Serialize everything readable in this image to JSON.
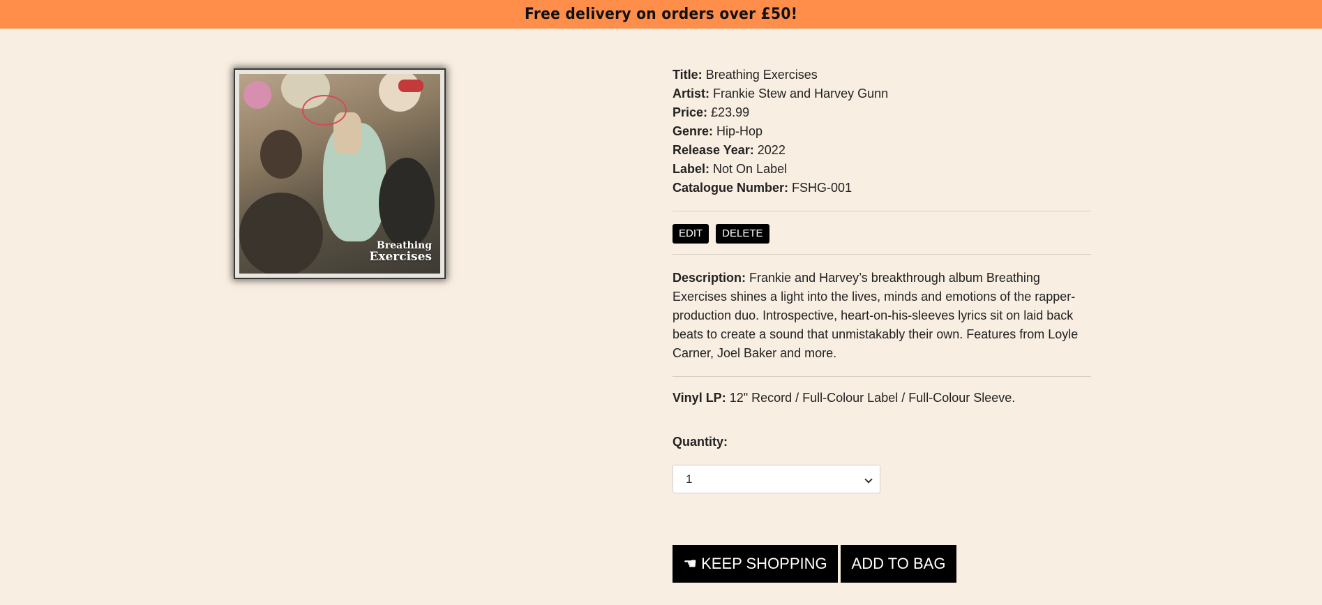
{
  "banner": {
    "text": "Free delivery on orders over £50!"
  },
  "cover": {
    "title_line1": "Breathing",
    "title_line2": "Exercises"
  },
  "product": {
    "fields": [
      {
        "key": "Title:",
        "value": "Breathing Exercises"
      },
      {
        "key": "Artist:",
        "value": "Frankie Stew and Harvey Gunn"
      },
      {
        "key": "Price:",
        "value": "£23.99"
      },
      {
        "key": "Genre:",
        "value": "Hip-Hop"
      },
      {
        "key": "Release Year:",
        "value": "2022"
      },
      {
        "key": "Label:",
        "value": "Not On Label"
      },
      {
        "key": "Catalogue Number:",
        "value": "FSHG-001"
      }
    ],
    "edit_label": "EDIT",
    "delete_label": "DELETE",
    "description_key": "Description:",
    "description": "Frankie and Harvey’s breakthrough album Breathing Exercises shines a light into the lives, minds and emotions of the rapper-production duo. Introspective, heart-on-his-sleeves lyrics sit on laid back beats to create a sound that unmistakably their own. Features from Loyle Carner, Joel Baker and more.",
    "format_key": "Vinyl LP:",
    "format_value": "12\" Record / Full-Colour Label / Full-Colour Sleeve.",
    "quantity_label": "Quantity:",
    "quantity_value": "1",
    "keep_shopping_label": "KEEP SHOPPING",
    "add_to_bag_label": "ADD TO BAG"
  },
  "icons": {
    "keep_shopping": "pointing-hand-icon",
    "select": "chevron-down-icon"
  },
  "colors": {
    "banner": "#ff8e4b",
    "background": "#f8eee1",
    "button": "#000000"
  }
}
